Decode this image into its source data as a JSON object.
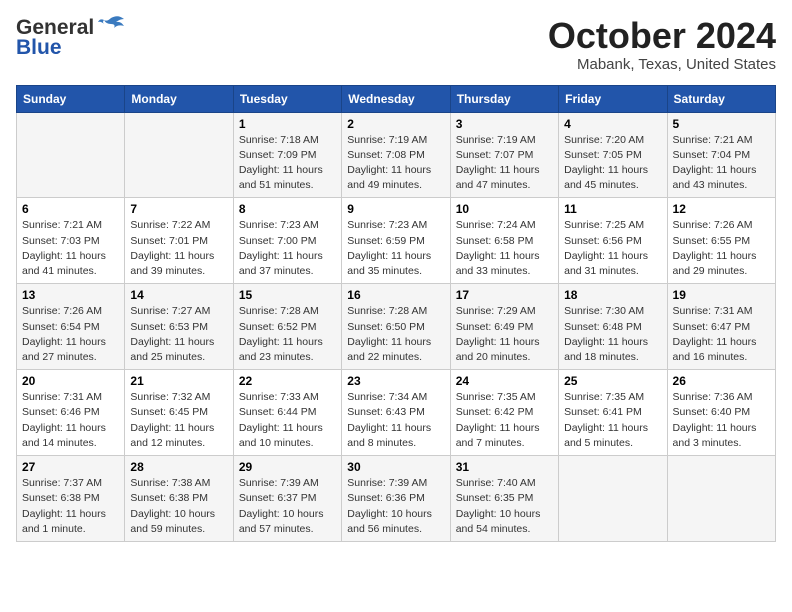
{
  "header": {
    "logo_general": "General",
    "logo_blue": "Blue",
    "month": "October 2024",
    "location": "Mabank, Texas, United States"
  },
  "weekdays": [
    "Sunday",
    "Monday",
    "Tuesday",
    "Wednesday",
    "Thursday",
    "Friday",
    "Saturday"
  ],
  "weeks": [
    [
      {
        "day": "",
        "info": ""
      },
      {
        "day": "",
        "info": ""
      },
      {
        "day": "1",
        "info": "Sunrise: 7:18 AM\nSunset: 7:09 PM\nDaylight: 11 hours and 51 minutes."
      },
      {
        "day": "2",
        "info": "Sunrise: 7:19 AM\nSunset: 7:08 PM\nDaylight: 11 hours and 49 minutes."
      },
      {
        "day": "3",
        "info": "Sunrise: 7:19 AM\nSunset: 7:07 PM\nDaylight: 11 hours and 47 minutes."
      },
      {
        "day": "4",
        "info": "Sunrise: 7:20 AM\nSunset: 7:05 PM\nDaylight: 11 hours and 45 minutes."
      },
      {
        "day": "5",
        "info": "Sunrise: 7:21 AM\nSunset: 7:04 PM\nDaylight: 11 hours and 43 minutes."
      }
    ],
    [
      {
        "day": "6",
        "info": "Sunrise: 7:21 AM\nSunset: 7:03 PM\nDaylight: 11 hours and 41 minutes."
      },
      {
        "day": "7",
        "info": "Sunrise: 7:22 AM\nSunset: 7:01 PM\nDaylight: 11 hours and 39 minutes."
      },
      {
        "day": "8",
        "info": "Sunrise: 7:23 AM\nSunset: 7:00 PM\nDaylight: 11 hours and 37 minutes."
      },
      {
        "day": "9",
        "info": "Sunrise: 7:23 AM\nSunset: 6:59 PM\nDaylight: 11 hours and 35 minutes."
      },
      {
        "day": "10",
        "info": "Sunrise: 7:24 AM\nSunset: 6:58 PM\nDaylight: 11 hours and 33 minutes."
      },
      {
        "day": "11",
        "info": "Sunrise: 7:25 AM\nSunset: 6:56 PM\nDaylight: 11 hours and 31 minutes."
      },
      {
        "day": "12",
        "info": "Sunrise: 7:26 AM\nSunset: 6:55 PM\nDaylight: 11 hours and 29 minutes."
      }
    ],
    [
      {
        "day": "13",
        "info": "Sunrise: 7:26 AM\nSunset: 6:54 PM\nDaylight: 11 hours and 27 minutes."
      },
      {
        "day": "14",
        "info": "Sunrise: 7:27 AM\nSunset: 6:53 PM\nDaylight: 11 hours and 25 minutes."
      },
      {
        "day": "15",
        "info": "Sunrise: 7:28 AM\nSunset: 6:52 PM\nDaylight: 11 hours and 23 minutes."
      },
      {
        "day": "16",
        "info": "Sunrise: 7:28 AM\nSunset: 6:50 PM\nDaylight: 11 hours and 22 minutes."
      },
      {
        "day": "17",
        "info": "Sunrise: 7:29 AM\nSunset: 6:49 PM\nDaylight: 11 hours and 20 minutes."
      },
      {
        "day": "18",
        "info": "Sunrise: 7:30 AM\nSunset: 6:48 PM\nDaylight: 11 hours and 18 minutes."
      },
      {
        "day": "19",
        "info": "Sunrise: 7:31 AM\nSunset: 6:47 PM\nDaylight: 11 hours and 16 minutes."
      }
    ],
    [
      {
        "day": "20",
        "info": "Sunrise: 7:31 AM\nSunset: 6:46 PM\nDaylight: 11 hours and 14 minutes."
      },
      {
        "day": "21",
        "info": "Sunrise: 7:32 AM\nSunset: 6:45 PM\nDaylight: 11 hours and 12 minutes."
      },
      {
        "day": "22",
        "info": "Sunrise: 7:33 AM\nSunset: 6:44 PM\nDaylight: 11 hours and 10 minutes."
      },
      {
        "day": "23",
        "info": "Sunrise: 7:34 AM\nSunset: 6:43 PM\nDaylight: 11 hours and 8 minutes."
      },
      {
        "day": "24",
        "info": "Sunrise: 7:35 AM\nSunset: 6:42 PM\nDaylight: 11 hours and 7 minutes."
      },
      {
        "day": "25",
        "info": "Sunrise: 7:35 AM\nSunset: 6:41 PM\nDaylight: 11 hours and 5 minutes."
      },
      {
        "day": "26",
        "info": "Sunrise: 7:36 AM\nSunset: 6:40 PM\nDaylight: 11 hours and 3 minutes."
      }
    ],
    [
      {
        "day": "27",
        "info": "Sunrise: 7:37 AM\nSunset: 6:38 PM\nDaylight: 11 hours and 1 minute."
      },
      {
        "day": "28",
        "info": "Sunrise: 7:38 AM\nSunset: 6:38 PM\nDaylight: 10 hours and 59 minutes."
      },
      {
        "day": "29",
        "info": "Sunrise: 7:39 AM\nSunset: 6:37 PM\nDaylight: 10 hours and 57 minutes."
      },
      {
        "day": "30",
        "info": "Sunrise: 7:39 AM\nSunset: 6:36 PM\nDaylight: 10 hours and 56 minutes."
      },
      {
        "day": "31",
        "info": "Sunrise: 7:40 AM\nSunset: 6:35 PM\nDaylight: 10 hours and 54 minutes."
      },
      {
        "day": "",
        "info": ""
      },
      {
        "day": "",
        "info": ""
      }
    ]
  ]
}
